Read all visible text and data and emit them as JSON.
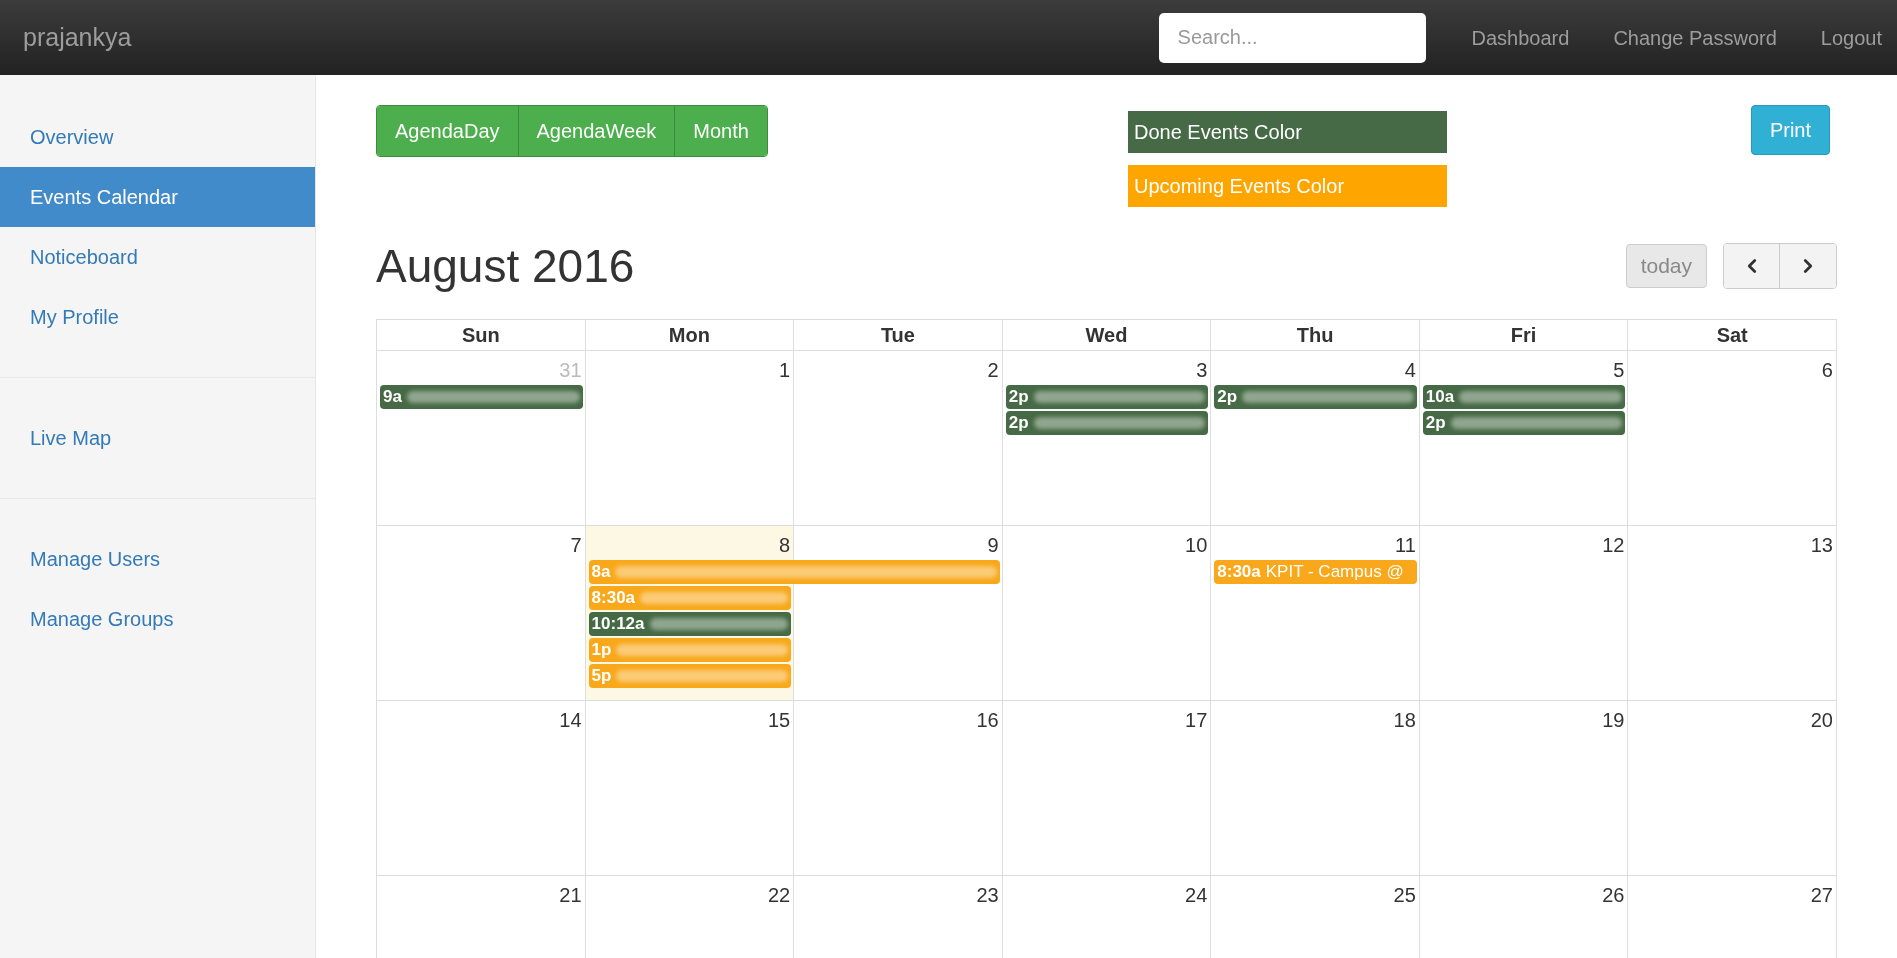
{
  "navbar": {
    "brand": "prajankya",
    "search": {
      "placeholder": "Search..."
    },
    "links": [
      "Dashboard",
      "Change Password",
      "Logout"
    ]
  },
  "sidebar": {
    "groups": [
      [
        {
          "label": "Overview",
          "selected": false
        },
        {
          "label": "Events Calendar",
          "selected": true
        },
        {
          "label": "Noticeboard",
          "selected": false
        },
        {
          "label": "My Profile",
          "selected": false
        }
      ],
      [
        {
          "label": "Live Map",
          "selected": false
        }
      ],
      [
        {
          "label": "Manage Users",
          "selected": false
        },
        {
          "label": "Manage Groups",
          "selected": false
        }
      ]
    ]
  },
  "views": [
    {
      "label": "AgendaDay",
      "selected": false
    },
    {
      "label": "AgendaWeek",
      "selected": false
    },
    {
      "label": "Month",
      "selected": false
    }
  ],
  "legend": [
    {
      "label": "Done Events Color",
      "color": "#466a45"
    },
    {
      "label": "Upcoming Events Color",
      "color": "#ffa500"
    }
  ],
  "print": "Print",
  "calendar": {
    "title": "August 2016",
    "today_button": "today",
    "weekdays": [
      "Sun",
      "Mon",
      "Tue",
      "Wed",
      "Thu",
      "Fri",
      "Sat"
    ],
    "weeks": [
      [
        {
          "date": "31",
          "other_month": true,
          "today": false,
          "events": [
            {
              "time": "9a",
              "kind": "done",
              "blurred": true
            }
          ]
        },
        {
          "date": "1",
          "other_month": false,
          "today": false
        },
        {
          "date": "2",
          "other_month": false,
          "today": false
        },
        {
          "date": "3",
          "other_month": false,
          "today": false,
          "events": [
            {
              "time": "2p",
              "kind": "done",
              "blurred": true
            },
            {
              "time": "2p",
              "kind": "done",
              "blurred": true
            }
          ]
        },
        {
          "date": "4",
          "other_month": false,
          "today": false,
          "events": [
            {
              "time": "2p",
              "kind": "done",
              "blurred": true
            }
          ]
        },
        {
          "date": "5",
          "other_month": false,
          "today": false,
          "events": [
            {
              "time": "10a",
              "kind": "done",
              "blurred": true
            },
            {
              "time": "2p",
              "kind": "done",
              "blurred": true
            }
          ]
        },
        {
          "date": "6",
          "other_month": false,
          "today": false
        }
      ],
      [
        {
          "date": "7",
          "other_month": false,
          "today": false
        },
        {
          "date": "8",
          "other_month": false,
          "today": true,
          "events": [
            {
              "time": "8a",
              "kind": "upcoming",
              "multi_day": true,
              "blurred": true
            },
            {
              "time": "8:30a",
              "kind": "upcoming",
              "blurred": true
            },
            {
              "time": "10:12a",
              "kind": "done",
              "blurred": true
            },
            {
              "time": "1p",
              "kind": "upcoming",
              "blurred": true
            },
            {
              "time": "5p",
              "kind": "upcoming",
              "blurred": true
            }
          ]
        },
        {
          "date": "9",
          "other_month": false,
          "today": false
        },
        {
          "date": "10",
          "other_month": false,
          "today": false
        },
        {
          "date": "11",
          "other_month": false,
          "today": false,
          "events": [
            {
              "time": "8:30a",
              "title": "KPIT - Campus @",
              "kind": "upcoming"
            }
          ]
        },
        {
          "date": "12",
          "other_month": false,
          "today": false
        },
        {
          "date": "13",
          "other_month": false,
          "today": false
        }
      ],
      [
        {
          "date": "14",
          "other_month": false,
          "today": false
        },
        {
          "date": "15",
          "other_month": false,
          "today": false
        },
        {
          "date": "16",
          "other_month": false,
          "today": false
        },
        {
          "date": "17",
          "other_month": false,
          "today": false
        },
        {
          "date": "18",
          "other_month": false,
          "today": false
        },
        {
          "date": "19",
          "other_month": false,
          "today": false
        },
        {
          "date": "20",
          "other_month": false,
          "today": false
        }
      ],
      [
        {
          "date": "21",
          "other_month": false,
          "today": false
        },
        {
          "date": "22",
          "other_month": false,
          "today": false
        },
        {
          "date": "23",
          "other_month": false,
          "today": false
        },
        {
          "date": "24",
          "other_month": false,
          "today": false
        },
        {
          "date": "25",
          "other_month": false,
          "today": false
        },
        {
          "date": "26",
          "other_month": false,
          "today": false
        },
        {
          "date": "27",
          "other_month": false,
          "today": false
        }
      ]
    ]
  }
}
